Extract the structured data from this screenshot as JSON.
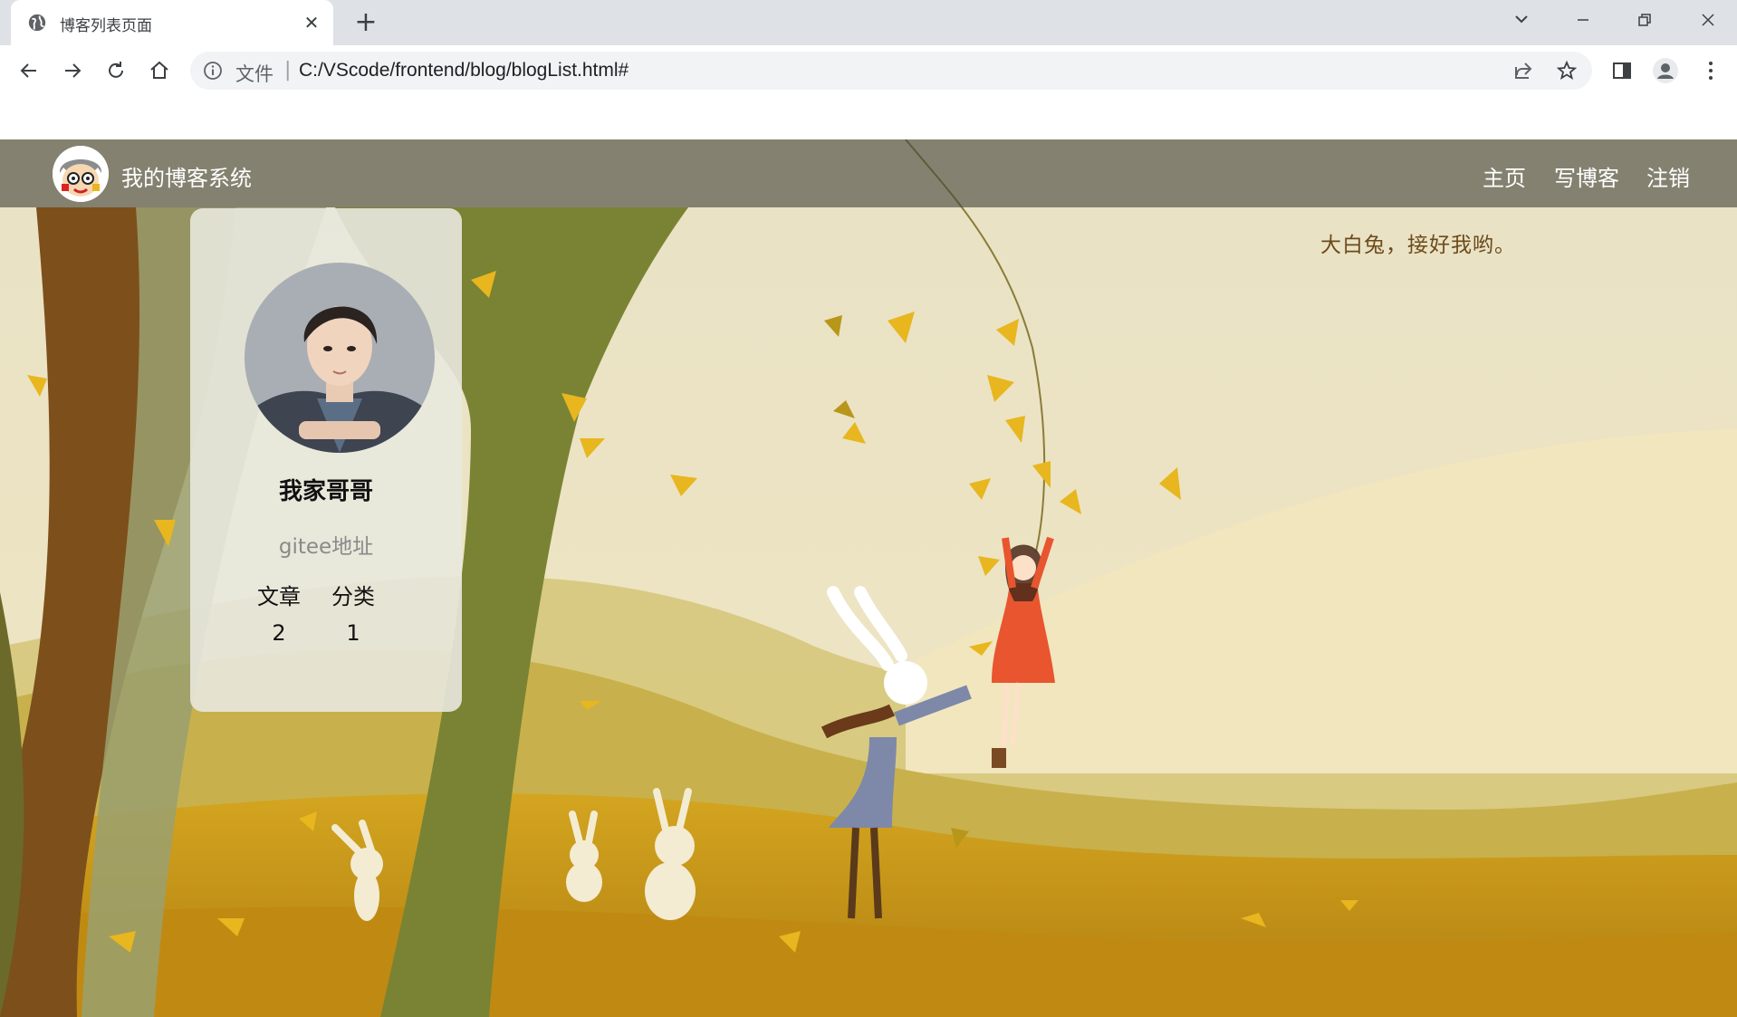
{
  "browser": {
    "tab_title": "博客列表页面",
    "address_scheme": "文件",
    "address_url": "C:/VScode/frontend/blog/blogList.html#"
  },
  "navbar": {
    "site_title": "我的博客系统",
    "links": [
      "主页",
      "写博客",
      "注销"
    ]
  },
  "banner_quote": "大白兔，接好我哟。",
  "profile": {
    "name": "我家哥哥",
    "link_text": "gitee地址",
    "stats": [
      {
        "label": "文章",
        "value": "2"
      },
      {
        "label": "分类",
        "value": "1"
      }
    ]
  },
  "colors": {
    "navbar_bg": "#46463c",
    "accent_leaf": "#e8b61e",
    "card_bg": "#e8e8de"
  }
}
